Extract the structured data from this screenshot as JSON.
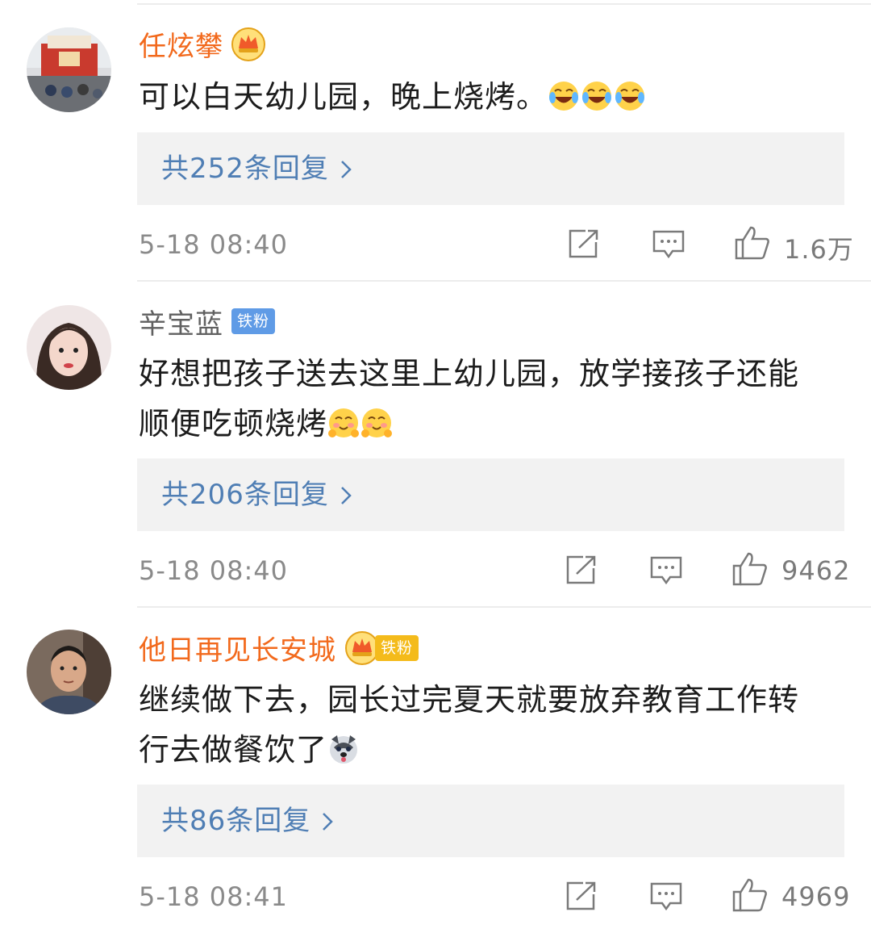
{
  "comments": [
    {
      "user": "任炫攀",
      "badges": [
        "crown"
      ],
      "text": "可以白天幼儿园，晚上烧烤。",
      "emojis": [
        "laugh-cry-emoji",
        "laugh-cry-emoji",
        "laugh-cry-emoji"
      ],
      "replies_label": "共252条回复",
      "time": "5-18 08:40",
      "likes": "1.6万"
    },
    {
      "user": "辛宝蓝",
      "badges": [
        "tiefen"
      ],
      "tiefen_label": "铁粉",
      "text_lines": [
        "好想把孩子送去这里上幼儿园，放学接孩子还能",
        "顺便吃顿烧烤"
      ],
      "emojis": [
        "blush-hug-emoji",
        "blush-hug-emoji"
      ],
      "replies_label": "共206条回复",
      "time": "5-18 08:40",
      "likes": "9462"
    },
    {
      "user": "他日再见长安城",
      "badges": [
        "crown",
        "tiefen"
      ],
      "tiefen_label": "铁粉",
      "text_lines": [
        "继续做下去，园长过完夏天就要放弃教育工作转",
        "行去做餐饮了"
      ],
      "emojis": [
        "husky-emoji"
      ],
      "replies_label": "共86条回复",
      "time": "5-18 08:41",
      "likes": "4969"
    }
  ],
  "colors": {
    "vip_name": "#f2691c",
    "normal_name": "#606060",
    "reply_link": "#4f7eb4",
    "reply_bg": "#f2f2f2",
    "tiefen_blue": "#5f9be6",
    "tiefen_gold": "#f4bb1b"
  },
  "icons": {
    "share": "share-icon",
    "comment": "comment-icon",
    "like": "thumbs-up-icon",
    "chevron": "chevron-right-icon"
  }
}
